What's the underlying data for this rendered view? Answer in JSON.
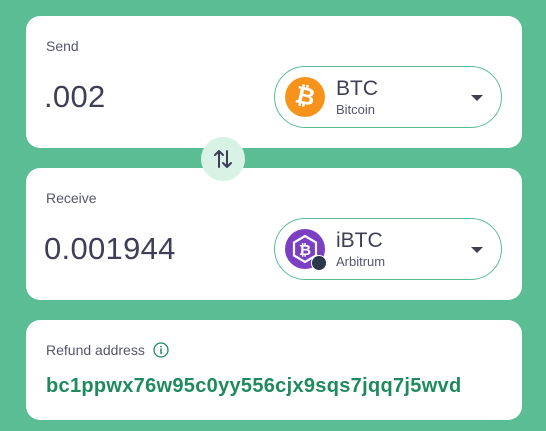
{
  "send": {
    "label": "Send",
    "amount": ".002",
    "token": {
      "symbol": "BTC",
      "chain": "Bitcoin",
      "icon": "bitcoin-icon",
      "color": "#f7931a",
      "glyph": "₿"
    }
  },
  "swap": {
    "icon": "swap-arrows-icon"
  },
  "receive": {
    "label": "Receive",
    "amount": "0.001944",
    "token": {
      "symbol": "iBTC",
      "chain": "Arbitrum",
      "icon": "ibtc-icon",
      "color": "#7a3fc2",
      "glyph": "₿"
    }
  },
  "refund": {
    "label": "Refund address",
    "info_icon": "info-icon",
    "address": "bc1ppwx76w95c0yy556cjx9sqs7jqq7j5wvd"
  },
  "colors": {
    "background": "#5bbd94",
    "accent": "#1e8a5d",
    "text": "#3e3f56"
  }
}
